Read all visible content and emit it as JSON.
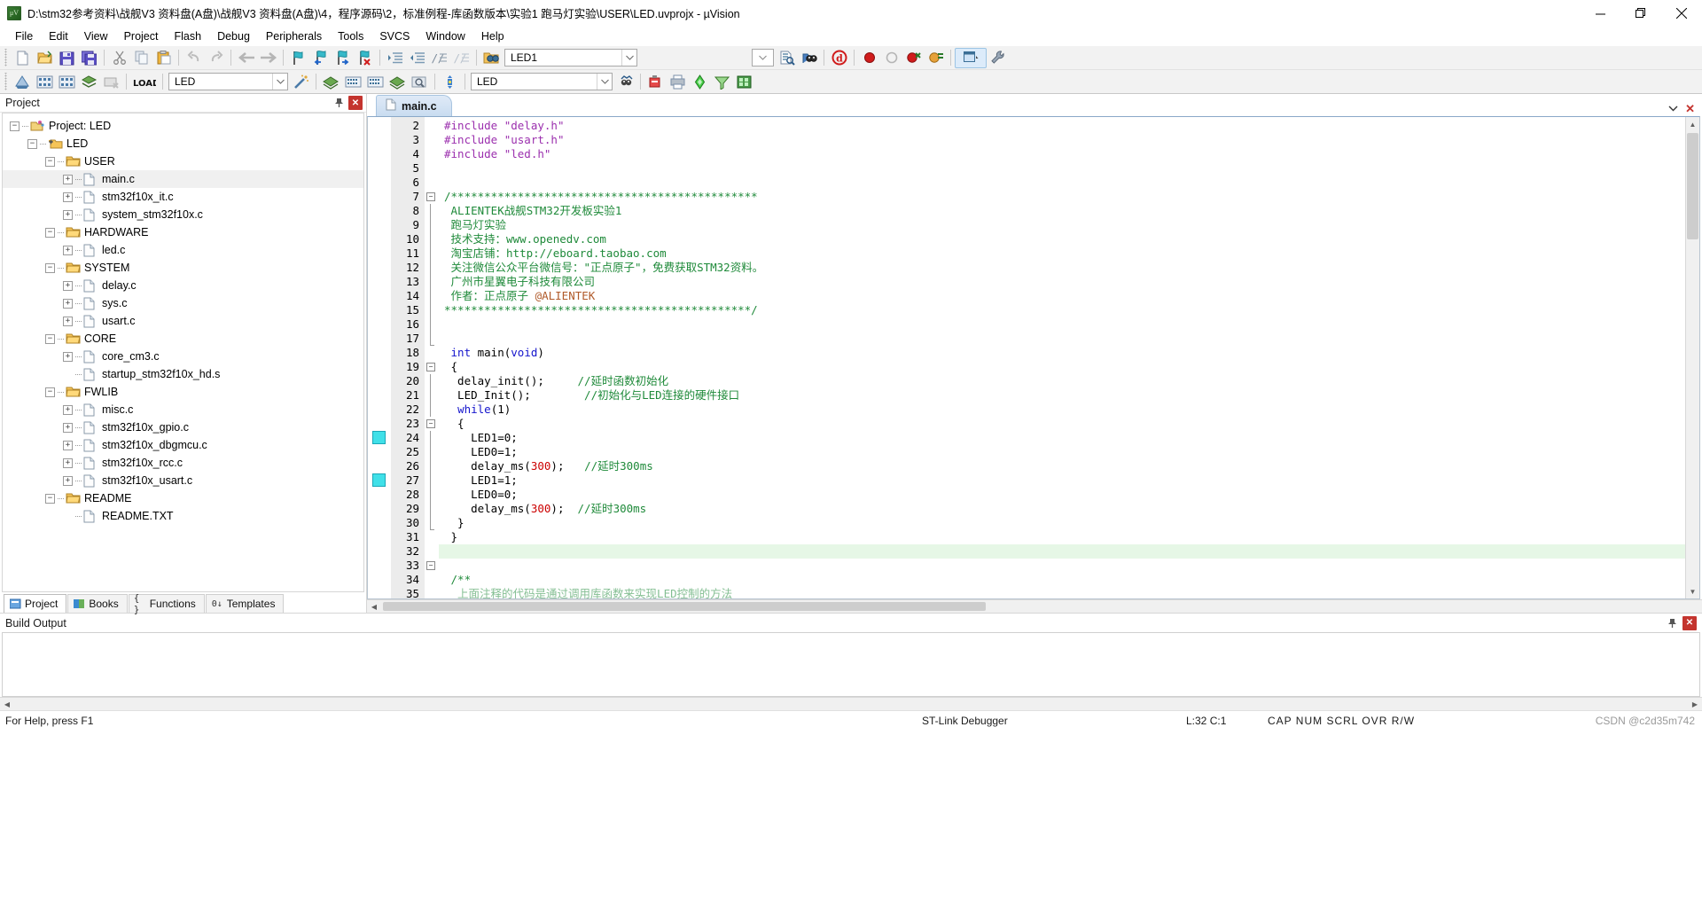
{
  "window": {
    "title": "D:\\stm32参考资料\\战舰V3 资料盘(A盘)\\战舰V3 资料盘(A盘)\\4，程序源码\\2，标准例程-库函数版本\\实验1 跑马灯实验\\USER\\LED.uvprojx - µVision",
    "app_icon": "uvision-logo-icon",
    "minimize_label": "Minimize",
    "restore_label": "Restore",
    "close_label": "Close"
  },
  "menubar": {
    "items": [
      {
        "label": "File"
      },
      {
        "label": "Edit"
      },
      {
        "label": "View"
      },
      {
        "label": "Project"
      },
      {
        "label": "Flash"
      },
      {
        "label": "Debug"
      },
      {
        "label": "Peripherals"
      },
      {
        "label": "Tools"
      },
      {
        "label": "SVCS"
      },
      {
        "label": "Window"
      },
      {
        "label": "Help"
      }
    ]
  },
  "toolbar_main": {
    "buttons": [
      {
        "name": "new-file-button",
        "icon": "new-document-icon"
      },
      {
        "name": "open-file-button",
        "icon": "open-folder-icon"
      },
      {
        "name": "save-button",
        "icon": "floppy-save-icon"
      },
      {
        "name": "save-all-button",
        "icon": "floppy-save-all-icon"
      },
      {
        "name": "cut-button",
        "icon": "scissors-icon"
      },
      {
        "name": "copy-button",
        "icon": "copy-pages-icon"
      },
      {
        "name": "paste-button",
        "icon": "clipboard-paste-icon"
      },
      {
        "name": "undo-button",
        "icon": "undo-arrow-icon"
      },
      {
        "name": "redo-button",
        "icon": "redo-arrow-icon"
      },
      {
        "name": "navigate-back-button",
        "icon": "arrow-left-icon"
      },
      {
        "name": "navigate-forward-button",
        "icon": "arrow-right-icon"
      },
      {
        "name": "toggle-bookmark-button",
        "icon": "bookmark-flag-icon"
      },
      {
        "name": "previous-bookmark-button",
        "icon": "bookmark-flag-left-icon"
      },
      {
        "name": "next-bookmark-button",
        "icon": "bookmark-flag-right-icon"
      },
      {
        "name": "clear-bookmarks-button",
        "icon": "bookmark-flag-delete-icon"
      },
      {
        "name": "indent-button",
        "icon": "indent-right-icon"
      },
      {
        "name": "outdent-button",
        "icon": "indent-left-icon"
      },
      {
        "name": "comment-button",
        "icon": "comment-lines-icon"
      },
      {
        "name": "uncomment-button",
        "icon": "uncomment-lines-icon"
      },
      {
        "name": "find-in-files-button",
        "icon": "binoculars-folder-icon"
      }
    ],
    "search_value": "LED1",
    "search_placeholder": "",
    "right_buttons": [
      {
        "name": "find-next-button",
        "icon": "document-search-icon"
      },
      {
        "name": "browse-symbol-button",
        "icon": "binoculars-blue-icon"
      },
      {
        "name": "start-debug-button",
        "icon": "debug-red-d-icon"
      },
      {
        "name": "insert-breakpoint-button",
        "icon": "breakpoint-red-dot-icon"
      },
      {
        "name": "disable-breakpoint-button",
        "icon": "breakpoint-hollow-icon"
      },
      {
        "name": "kill-all-breakpoints-button",
        "icon": "breakpoint-kill-icon"
      },
      {
        "name": "disable-all-breakpoints-button",
        "icon": "breakpoint-disable-all-icon"
      }
    ],
    "window_mode": {
      "name": "window-layout-dropdown",
      "icon": "window-layout-icon"
    },
    "config_button": {
      "name": "configuration-wizard-button",
      "icon": "wrench-icon"
    }
  },
  "toolbar_build": {
    "buttons": [
      {
        "name": "translate-button",
        "icon": "translate-file-icon"
      },
      {
        "name": "build-button",
        "icon": "build-target-icon"
      },
      {
        "name": "rebuild-button",
        "icon": "rebuild-all-icon"
      },
      {
        "name": "batch-build-button",
        "icon": "batch-build-icon"
      },
      {
        "name": "stop-build-button",
        "icon": "stop-build-icon"
      },
      {
        "name": "download-button",
        "icon": "load-download-icon"
      },
      {
        "name": "target-options-button",
        "icon": "target-options-magic-wand-icon"
      }
    ],
    "target_value": "LED",
    "right_buttons": [
      {
        "name": "manage-project-items-button",
        "icon": "manage-components-icon"
      },
      {
        "name": "pack-installer-button",
        "icon": "pack-installer-icon"
      },
      {
        "name": "manage-run-time-button",
        "icon": "manage-runtime-env-icon"
      },
      {
        "name": "select-software-packs-button",
        "icon": "software-packs-icon"
      },
      {
        "name": "multi-project-button",
        "icon": "multi-project-icon"
      }
    ]
  },
  "project_panel": {
    "title": "Project",
    "pin_icon": "pin-icon",
    "close_icon": "close-panel-icon",
    "tree": [
      {
        "depth": 0,
        "label": "Project: LED",
        "expander": "minus",
        "icon": "project-icon",
        "selected": false
      },
      {
        "depth": 1,
        "label": "LED",
        "expander": "minus",
        "icon": "target-icon",
        "selected": false
      },
      {
        "depth": 2,
        "label": "USER",
        "expander": "minus",
        "icon": "folder-icon",
        "selected": false
      },
      {
        "depth": 3,
        "label": "main.c",
        "expander": "plus",
        "icon": "c-file-icon",
        "selected": true
      },
      {
        "depth": 3,
        "label": "stm32f10x_it.c",
        "expander": "plus",
        "icon": "c-file-icon",
        "selected": false
      },
      {
        "depth": 3,
        "label": "system_stm32f10x.c",
        "expander": "plus",
        "icon": "c-file-icon",
        "selected": false
      },
      {
        "depth": 2,
        "label": "HARDWARE",
        "expander": "minus",
        "icon": "folder-icon",
        "selected": false
      },
      {
        "depth": 3,
        "label": "led.c",
        "expander": "plus",
        "icon": "c-file-icon",
        "selected": false
      },
      {
        "depth": 2,
        "label": "SYSTEM",
        "expander": "minus",
        "icon": "folder-icon",
        "selected": false
      },
      {
        "depth": 3,
        "label": "delay.c",
        "expander": "plus",
        "icon": "c-file-icon",
        "selected": false
      },
      {
        "depth": 3,
        "label": "sys.c",
        "expander": "plus",
        "icon": "c-file-icon",
        "selected": false
      },
      {
        "depth": 3,
        "label": "usart.c",
        "expander": "plus",
        "icon": "c-file-icon",
        "selected": false
      },
      {
        "depth": 2,
        "label": "CORE",
        "expander": "minus",
        "icon": "folder-icon",
        "selected": false
      },
      {
        "depth": 3,
        "label": "core_cm3.c",
        "expander": "plus",
        "icon": "c-file-icon",
        "selected": false
      },
      {
        "depth": 3,
        "label": "startup_stm32f10x_hd.s",
        "expander": "none",
        "icon": "asm-file-icon",
        "selected": false
      },
      {
        "depth": 2,
        "label": "FWLIB",
        "expander": "minus",
        "icon": "folder-icon",
        "selected": false
      },
      {
        "depth": 3,
        "label": "misc.c",
        "expander": "plus",
        "icon": "c-file-icon",
        "selected": false
      },
      {
        "depth": 3,
        "label": "stm32f10x_gpio.c",
        "expander": "plus",
        "icon": "c-file-icon",
        "selected": false
      },
      {
        "depth": 3,
        "label": "stm32f10x_dbgmcu.c",
        "expander": "plus",
        "icon": "c-file-icon",
        "selected": false
      },
      {
        "depth": 3,
        "label": "stm32f10x_rcc.c",
        "expander": "plus",
        "icon": "c-file-icon",
        "selected": false
      },
      {
        "depth": 3,
        "label": "stm32f10x_usart.c",
        "expander": "plus",
        "icon": "c-file-icon",
        "selected": false
      },
      {
        "depth": 2,
        "label": "README",
        "expander": "minus",
        "icon": "folder-icon",
        "selected": false
      },
      {
        "depth": 3,
        "label": "README.TXT",
        "expander": "none",
        "icon": "txt-file-icon",
        "selected": false
      }
    ],
    "tabs": [
      {
        "label": "Project",
        "icon": "project-tab-icon",
        "active": true
      },
      {
        "label": "Books",
        "icon": "books-tab-icon",
        "active": false
      },
      {
        "label": "Functions",
        "icon": "functions-tab-icon",
        "active": false
      },
      {
        "label": "Templates",
        "icon": "templates-tab-icon",
        "active": false
      }
    ]
  },
  "editor": {
    "tabs": [
      {
        "label": "main.c",
        "icon": "c-file-icon",
        "active": true
      }
    ],
    "tab_controls": {
      "chevron_icon": "chevron-down-icon",
      "close_icon": "close-tab-icon"
    },
    "breakpoint_lines": [
      24,
      27
    ],
    "highlight_line": 32,
    "first_line_number": 2,
    "lines": [
      {
        "n": 2,
        "tokens": [
          {
            "t": "#include ",
            "c": "pre"
          },
          {
            "t": "\"delay.h\"",
            "c": "str"
          }
        ]
      },
      {
        "n": 3,
        "tokens": [
          {
            "t": "#include ",
            "c": "pre"
          },
          {
            "t": "\"usart.h\"",
            "c": "str"
          }
        ]
      },
      {
        "n": 4,
        "tokens": [
          {
            "t": "#include ",
            "c": "pre"
          },
          {
            "t": "\"led.h\"",
            "c": "str"
          }
        ]
      },
      {
        "n": 5,
        "tokens": []
      },
      {
        "n": 6,
        "tokens": []
      },
      {
        "n": 7,
        "tokens": [
          {
            "t": "/**********************************************",
            "c": "cmt"
          }
        ]
      },
      {
        "n": 8,
        "tokens": [
          {
            "t": " ALIENTEK战舰STM32开发板实验1",
            "c": "cmt"
          }
        ]
      },
      {
        "n": 9,
        "tokens": [
          {
            "t": " 跑马灯实验",
            "c": "cmt"
          }
        ]
      },
      {
        "n": 10,
        "tokens": [
          {
            "t": " 技术支持：www.openedv.com",
            "c": "cmt"
          }
        ]
      },
      {
        "n": 11,
        "tokens": [
          {
            "t": " 淘宝店铺：http://eboard.taobao.com",
            "c": "cmt"
          }
        ]
      },
      {
        "n": 12,
        "tokens": [
          {
            "t": " 关注微信公众平台微信号：\"正点原子\"，免费获取STM32资料。",
            "c": "cmt"
          }
        ]
      },
      {
        "n": 13,
        "tokens": [
          {
            "t": " 广州市星翼电子科技有限公司",
            "c": "cmt"
          }
        ]
      },
      {
        "n": 14,
        "tokens": [
          {
            "t": " 作者：正点原子 ",
            "c": "cmt"
          },
          {
            "t": "@ALIENTEK",
            "c": "at"
          }
        ]
      },
      {
        "n": 15,
        "tokens": [
          {
            "t": "**********************************************/",
            "c": "cmt"
          }
        ]
      },
      {
        "n": 16,
        "tokens": []
      },
      {
        "n": 17,
        "tokens": []
      },
      {
        "n": 18,
        "tokens": [
          {
            "t": " ",
            "c": "txt"
          },
          {
            "t": "int",
            "c": "kw"
          },
          {
            "t": " main(",
            "c": "txt"
          },
          {
            "t": "void",
            "c": "kw"
          },
          {
            "t": ")",
            "c": "txt"
          }
        ]
      },
      {
        "n": 19,
        "tokens": [
          {
            "t": " {",
            "c": "txt"
          }
        ]
      },
      {
        "n": 20,
        "tokens": [
          {
            "t": "  delay_init();     ",
            "c": "txt"
          },
          {
            "t": "//延时函数初始化",
            "c": "cmt"
          }
        ]
      },
      {
        "n": 21,
        "tokens": [
          {
            "t": "  LED_Init();        ",
            "c": "txt"
          },
          {
            "t": "//初始化与LED连接的硬件接口",
            "c": "cmt"
          }
        ]
      },
      {
        "n": 22,
        "tokens": [
          {
            "t": "  ",
            "c": "txt"
          },
          {
            "t": "while",
            "c": "kw"
          },
          {
            "t": "(1)",
            "c": "txt"
          }
        ]
      },
      {
        "n": 23,
        "tokens": [
          {
            "t": "  {",
            "c": "txt"
          }
        ]
      },
      {
        "n": 24,
        "tokens": [
          {
            "t": "    LED1=0;",
            "c": "txt"
          }
        ]
      },
      {
        "n": 25,
        "tokens": [
          {
            "t": "    LED0=1;",
            "c": "txt"
          }
        ]
      },
      {
        "n": 26,
        "tokens": [
          {
            "t": "    delay_ms(",
            "c": "txt"
          },
          {
            "t": "300",
            "c": "num"
          },
          {
            "t": ");   ",
            "c": "txt"
          },
          {
            "t": "//延时300ms",
            "c": "cmt"
          }
        ]
      },
      {
        "n": 27,
        "tokens": [
          {
            "t": "    LED1=1;",
            "c": "txt"
          }
        ]
      },
      {
        "n": 28,
        "tokens": [
          {
            "t": "    LED0=0;",
            "c": "txt"
          }
        ]
      },
      {
        "n": 29,
        "tokens": [
          {
            "t": "    delay_ms(",
            "c": "txt"
          },
          {
            "t": "300",
            "c": "num"
          },
          {
            "t": ");  ",
            "c": "txt"
          },
          {
            "t": "//延时300ms",
            "c": "cmt"
          }
        ]
      },
      {
        "n": 30,
        "tokens": [
          {
            "t": "  }",
            "c": "txt"
          }
        ]
      },
      {
        "n": 31,
        "tokens": [
          {
            "t": " }",
            "c": "txt"
          }
        ]
      },
      {
        "n": 32,
        "tokens": []
      },
      {
        "n": 33,
        "tokens": []
      },
      {
        "n": 34,
        "tokens": [
          {
            "t": " /**",
            "c": "cmt"
          }
        ]
      },
      {
        "n": 35,
        "tokens": [
          {
            "t": "  上面注释的代码是通过调用库函数来实现LED控制的方法",
            "c": "cmt"
          }
        ]
      }
    ]
  },
  "build_output": {
    "title": "Build Output",
    "pin_icon": "pin-icon",
    "close_icon": "close-panel-icon",
    "content": ""
  },
  "statusbar": {
    "help_text": "For Help, press F1",
    "debugger": "ST-Link Debugger",
    "cursor_position": "L:32 C:1",
    "caps_indicators": "CAP NUM SCRL OVR R/W",
    "watermark": "CSDN @c2d35m742"
  },
  "colors": {
    "accent_blue": "#1414cc",
    "comment_green": "#1f8a3a",
    "string_purple": "#9b2fae",
    "number_red": "#cc0000",
    "breakpoint_cyan": "#40e0e8",
    "highlight_green": "#e6f7e6",
    "panel_gray": "#f2f2f2"
  }
}
